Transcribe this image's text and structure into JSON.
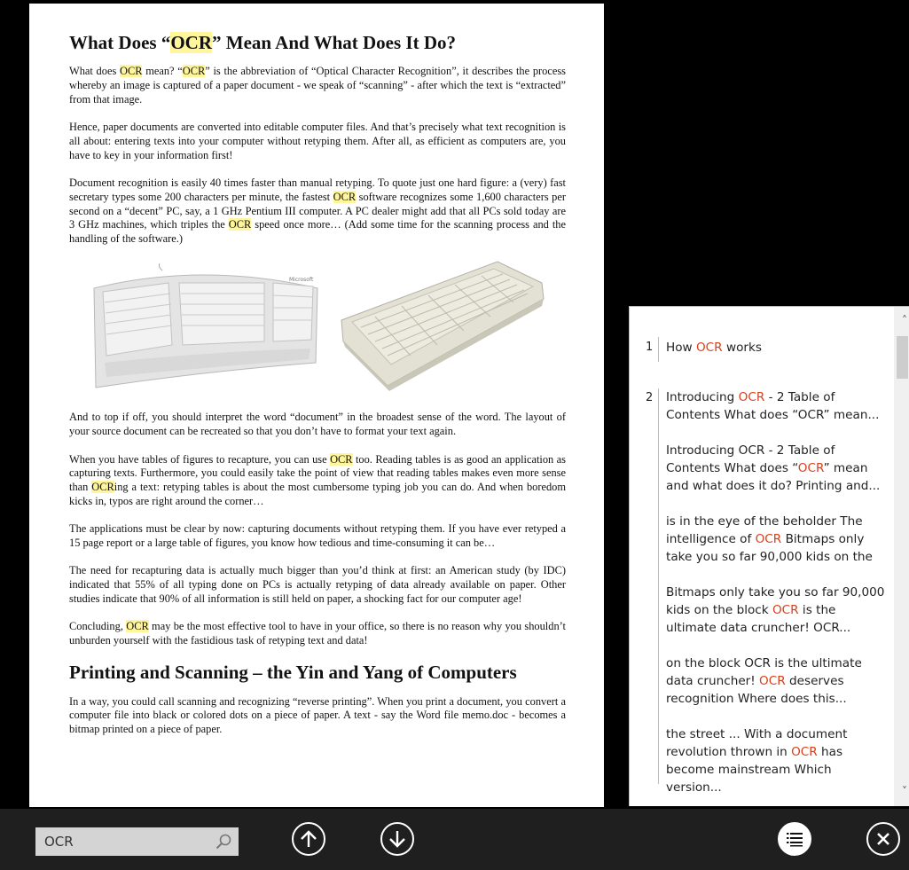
{
  "document": {
    "title_pre": "What Does “",
    "title_hl": "OCR",
    "title_post": "” Mean And What Does It Do?",
    "p1": {
      "a": "What does ",
      "b": "OCR",
      "c": " mean? “",
      "d": "OCR",
      "e": "” is the abbreviation of “Optical Character Recognition”, it describes the process whereby an image is captured of a paper document - we speak of “scanning” - after which the text is “extracted” from that image."
    },
    "p2": "Hence, paper documents are converted into editable computer files. And that’s precisely what text recognition is all about: entering texts into your computer without retyping them. After all, as efficient as computers are, you have to key in your information first!",
    "p3": {
      "a": "Document recognition is easily 40 times faster than manual retyping. To quote just one hard figure: a (very) fast secretary types some 200 characters per minute, the fastest ",
      "b": "OCR",
      "c": " software recognizes some 1,600 characters per second on a “decent” PC, say, a 1 GHz Pentium III computer. A PC dealer might add that all PCs sold today are 3 GHz machines, which triples the ",
      "d": "OCR",
      "e": " speed once more… (Add some time for the scanning process and the handling of the software.)"
    },
    "p4": "And to top if off, you should interpret the word “document” in the broadest sense of the word. The layout of your source document can be recreated so that you don’t have to format your text again.",
    "p5": {
      "a": "When you have tables of figures to recapture, you can use ",
      "b": "OCR",
      "c": " too. Reading tables is as good an application as capturing texts. Furthermore, you could easily take the point of view that reading tables makes even more sense than ",
      "d": "OCR",
      "e": "ing a text: retyping tables is about the most cumbersome typing job you can do. And when boredom kicks in, typos are right around the corner…"
    },
    "p6": "The applications must be clear by now: capturing documents without retyping them. If you have ever retyped a 15 page report or a large table of figures, you know how tedious and time-consuming it can be…",
    "p7": "The need for recapturing data is actually much bigger than you’d think at first: an American study (by IDC) indicated that 55% of all typing done on PCs is actually retyping of data already available on paper. Other studies indicate that 90% of all information is still held on paper, a shocking fact for our computer age!",
    "p8": {
      "a": "Concluding, ",
      "b": "OCR",
      "c": " may be the most effective tool to have in your office, so there is no reason why you shouldn’t unburden yourself with the fastidious task of retyping text and data!"
    },
    "h2": "Printing and Scanning – the Yin and Yang of Computers",
    "p9": "In a way, you could call scanning and recognizing “reverse printing”. When you print a document, you convert a computer file into black or colored dots on a piece of paper. A text - say the Word file memo.doc - becomes a bitmap printed on a piece of paper.",
    "keyboard_brand": "Microsoft"
  },
  "results": {
    "page1_num": "1",
    "page2_num": "2",
    "r1": {
      "a": "How ",
      "b": "OCR",
      "c": " works"
    },
    "r2": {
      "a": "Introducing ",
      "b": "OCR",
      "c": " - 2  Table of Contents   What does “OCR” mean..."
    },
    "r3": {
      "a": "Introducing OCR - 2  Table of Contents   What does “",
      "b": "OCR",
      "c": "” mean and what does it do?  Printing and..."
    },
    "r4": {
      "a": "is in the eye of the beholder  The intelligence of ",
      "b": "OCR",
      "c": "  Bitmaps only take you so far  90,000 kids on the"
    },
    "r5": {
      "a": "Bitmaps only take you so far  90,000 kids on the block  ",
      "b": "OCR",
      "c": " is the ultimate data cruncher!  OCR..."
    },
    "r6": {
      "a": "on the block  OCR is the ultimate data cruncher!  ",
      "b": "OCR",
      "c": " deserves recognition  Where does this..."
    },
    "r7": {
      "a": "the street  ... With a document revolution thrown in  ",
      "b": "OCR",
      "c": " has become mainstream  Which version..."
    }
  },
  "toolbar": {
    "search_value": "OCR"
  },
  "colors": {
    "highlight": "#fff59a",
    "match_text": "#d9401a",
    "bar_bg": "#1f1f1f"
  },
  "icons": {
    "search": "search-icon",
    "prev": "arrow-up-circle-icon",
    "next": "arrow-down-circle-icon",
    "list": "list-icon",
    "close": "close-circle-icon"
  }
}
